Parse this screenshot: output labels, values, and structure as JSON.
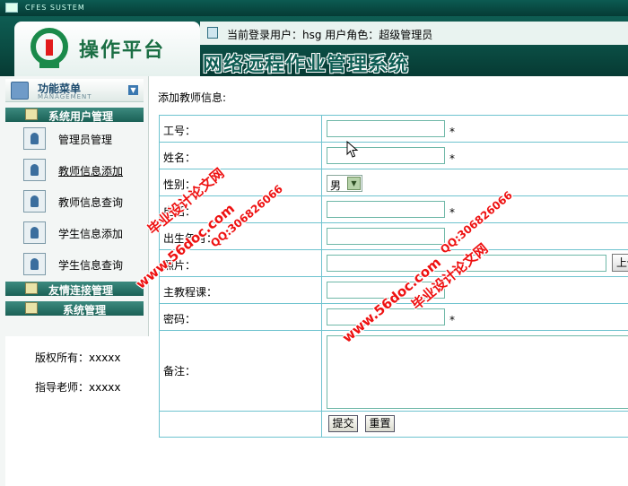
{
  "window": {
    "title": "CFES SUSTEM"
  },
  "header": {
    "logo_text": "操作平台",
    "user_info": "当前登录用户：hsg  用户角色：超级管理员",
    "system_title": "网络远程作业管理系统"
  },
  "sidebar": {
    "menu_title": "功能菜单",
    "menu_subtitle": "MANAGEMENT",
    "sections": [
      {
        "label": "系统用户管理"
      },
      {
        "label": "友情连接管理"
      },
      {
        "label": "系统管理"
      }
    ],
    "items": [
      {
        "label": "管理员管理",
        "active": false
      },
      {
        "label": "教师信息添加",
        "active": true
      },
      {
        "label": "教师信息查询",
        "active": false
      },
      {
        "label": "学生信息添加",
        "active": false
      },
      {
        "label": "学生信息查询",
        "active": false
      }
    ],
    "footer": {
      "copyright": "版权所有：xxxxx",
      "advisor": "指导老师：xxxxx"
    }
  },
  "main": {
    "page_label": "添加教师信息:",
    "form": {
      "fields": [
        {
          "label": "工号：",
          "value": "",
          "required": "*"
        },
        {
          "label": "姓名：",
          "value": "",
          "required": "*"
        },
        {
          "label": "性别：",
          "value": "男"
        },
        {
          "label": "电话：",
          "value": "",
          "required": "*"
        },
        {
          "label": "出生年月：",
          "value": ""
        },
        {
          "label": "照片：",
          "value": "",
          "upload_label": "上传"
        },
        {
          "label": "主教程课：",
          "value": ""
        },
        {
          "label": "密码：",
          "value": "",
          "required": "*"
        },
        {
          "label": "备注：",
          "value": ""
        }
      ],
      "submit_label": "提交",
      "reset_label": "重置"
    }
  },
  "watermarks": {
    "site": "www.56doc.com",
    "qq": "QQ:306826066",
    "brand": "毕业设计论文网"
  },
  "colors": {
    "header_green": "#0e5d53",
    "section_green": "#1b6156",
    "table_border": "#6fc3cf",
    "watermark_red": "#ee1111"
  }
}
